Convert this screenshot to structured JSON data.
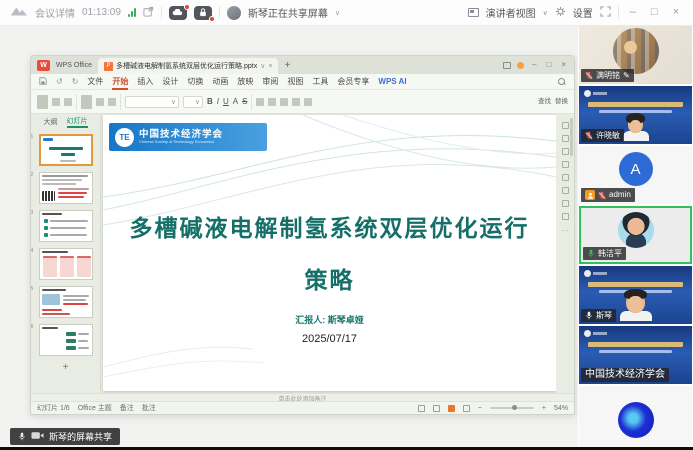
{
  "topbar": {
    "meeting_detail": "会议详情",
    "timer": "01:13:09",
    "sharing_status": "斯琴正在共享屏幕",
    "view_mode": "演讲者视图",
    "settings": "设置"
  },
  "glyphs": {
    "chevron": "∨",
    "minimize": "–",
    "maximize": "□",
    "close": "×",
    "plus": "+",
    "pencil": "✎",
    "ellipsis": "…",
    "zoom_out": "−",
    "zoom_in": "+"
  },
  "share_banner": {
    "text": "斯琴的屏幕共享"
  },
  "participants": [
    {
      "name": "满明铭",
      "mic": "muted"
    },
    {
      "name": "许晓敏",
      "mic": "muted"
    },
    {
      "name": "admin",
      "mic": "muted",
      "avatar_letter": "A",
      "host": true
    },
    {
      "name": "韩洁平",
      "mic": "active"
    },
    {
      "name": "斯琴",
      "mic": "on"
    },
    {
      "name": "中国技术经济学会",
      "mic": "none"
    },
    {
      "name": "",
      "mic": "none"
    }
  ],
  "wps": {
    "home_label": "WPS Office",
    "doc_tab": "多槽碱液电解制氢系统双层优化运行策略.pptx",
    "file_button": "文件",
    "ribbon_tabs": [
      "开始",
      "插入",
      "设计",
      "切换",
      "动画",
      "放映",
      "审阅",
      "视图",
      "工具",
      "会员专享",
      "WPS AI"
    ],
    "format_buttons": {
      "bold": "B",
      "italic": "I",
      "underline": "U",
      "font_color": "A",
      "strike": "S"
    },
    "edit_buttons": {
      "find": "查找",
      "replace": "替换"
    },
    "panel_tabs": {
      "outline": "大纲",
      "slides": "幻灯片"
    },
    "slide_numbers": [
      "1",
      "2",
      "3",
      "4",
      "5",
      "6"
    ],
    "notes_placeholder": "单击此处添加备注",
    "statusbar": {
      "slide_indicator": "幻灯片 1/6",
      "theme": "Office 主题",
      "notes": "备注",
      "comments": "批注",
      "zoom_level": "54%"
    }
  },
  "slide": {
    "logo_abbr": "TE",
    "org_cn": "中国技术经济学会",
    "org_en": "Chinese Society of Technology Economics",
    "title_line1": "多槽碱液电解制氢系统双层优化运行",
    "title_line2": "策略",
    "presenter": "汇报人: 斯琴卓娅",
    "date": "2025/07/17"
  },
  "colors": {
    "accent_teal": "#156f68",
    "logo_blue": "#1677c8",
    "active_green": "#2fc25a",
    "muted_red": "#ff5d55",
    "wps_orange": "#d2502c"
  }
}
